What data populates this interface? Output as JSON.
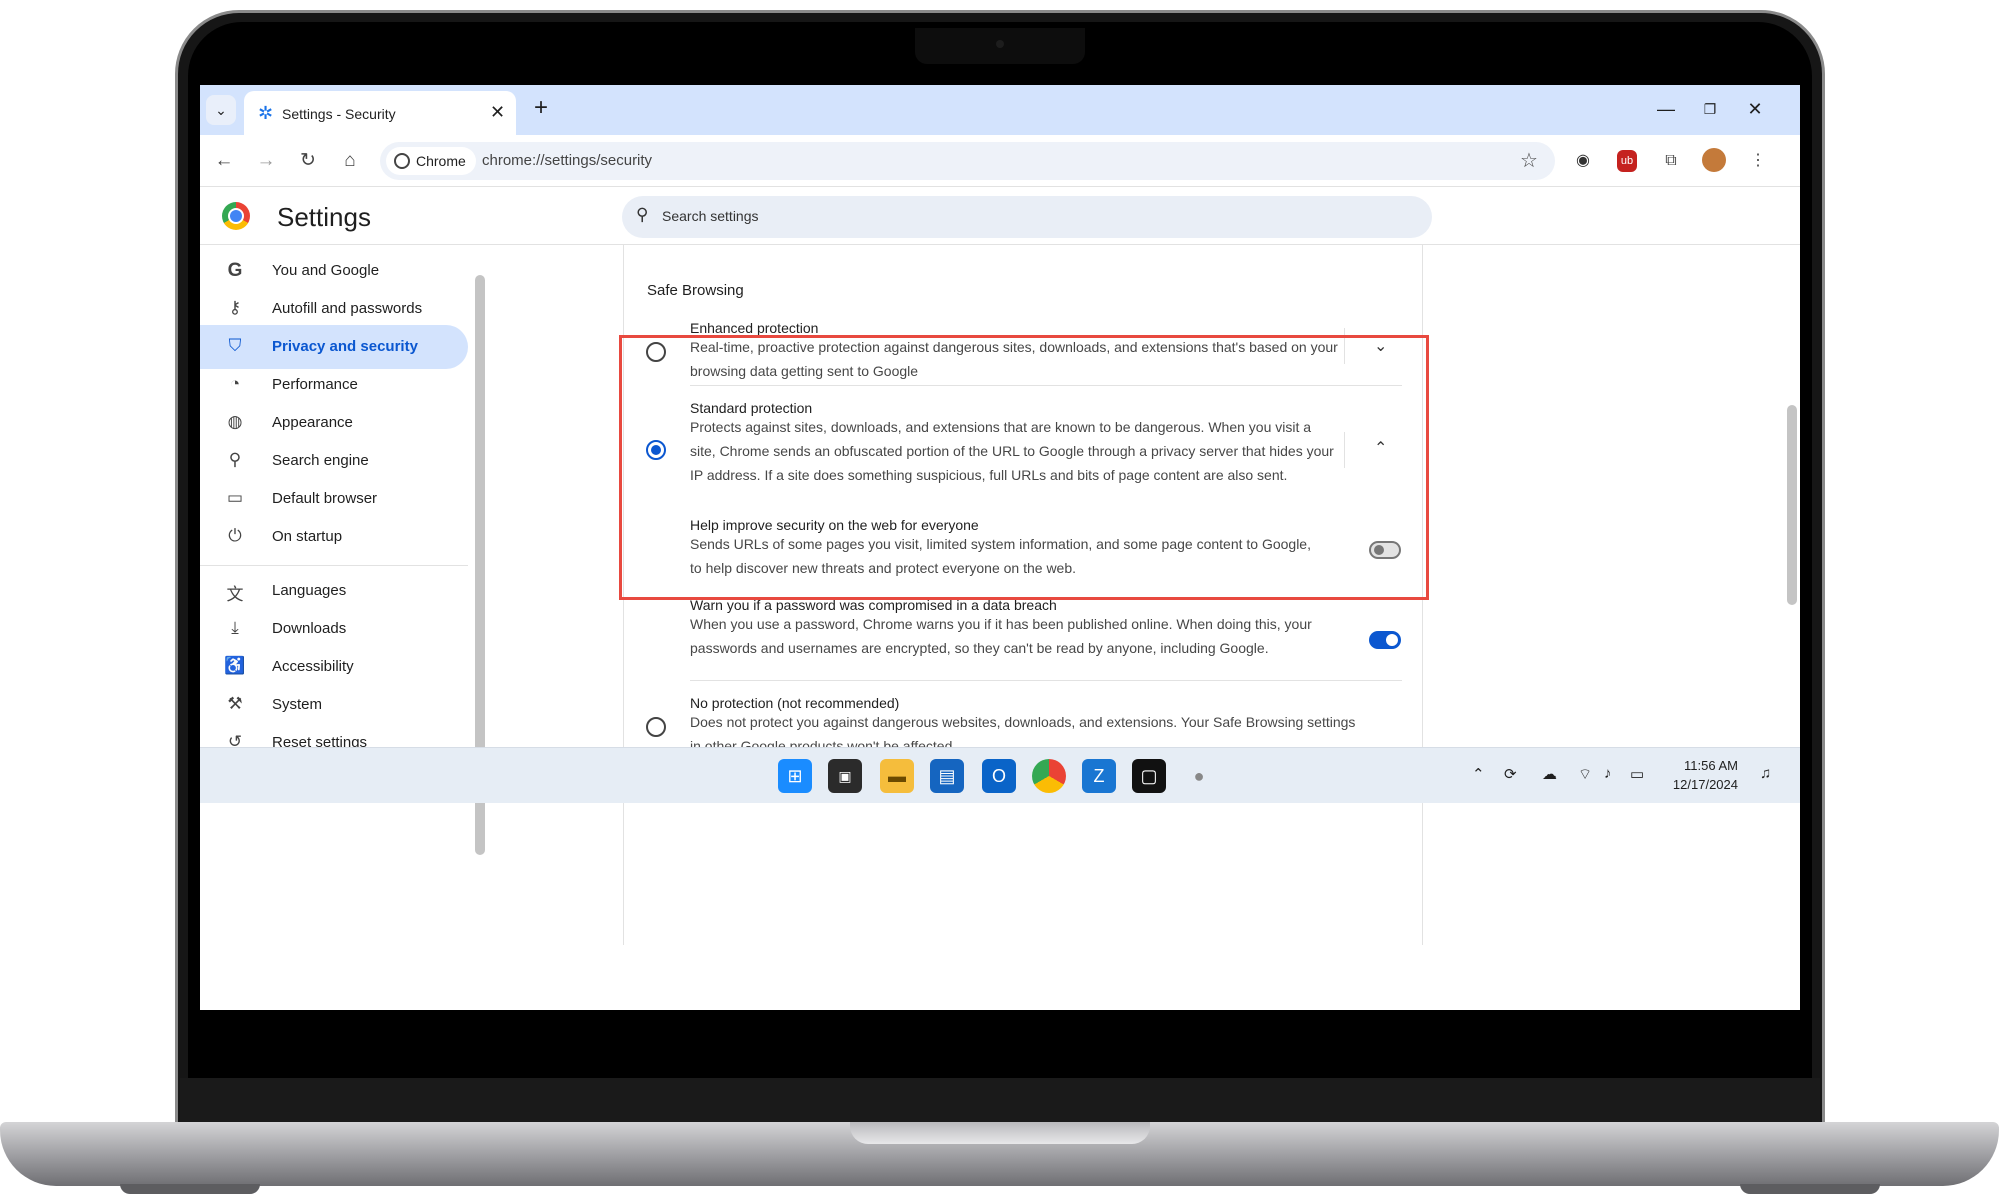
{
  "browser": {
    "tab_title": "Settings - Security",
    "chip_label": "Chrome",
    "url": "chrome://settings/security"
  },
  "settings": {
    "title": "Settings",
    "search_placeholder": "Search settings"
  },
  "sidebar": {
    "items": [
      {
        "label": "You and Google",
        "icon": "google-g-icon"
      },
      {
        "label": "Autofill and passwords",
        "icon": "key-icon"
      },
      {
        "label": "Privacy and security",
        "icon": "shield-icon",
        "active": true
      },
      {
        "label": "Performance",
        "icon": "speedometer-icon"
      },
      {
        "label": "Appearance",
        "icon": "palette-icon"
      },
      {
        "label": "Search engine",
        "icon": "search-icon"
      },
      {
        "label": "Default browser",
        "icon": "browser-window-icon"
      },
      {
        "label": "On startup",
        "icon": "power-icon"
      },
      {
        "label": "Languages",
        "icon": "translate-icon"
      },
      {
        "label": "Downloads",
        "icon": "download-icon"
      },
      {
        "label": "Accessibility",
        "icon": "accessibility-icon"
      },
      {
        "label": "System",
        "icon": "wrench-icon"
      },
      {
        "label": "Reset settings",
        "icon": "reset-icon"
      }
    ]
  },
  "safe_browsing": {
    "heading": "Safe Browsing",
    "enhanced": {
      "title": "Enhanced protection",
      "desc": "Real-time, proactive protection against dangerous sites, downloads, and extensions that's based on your browsing data getting sent to Google",
      "selected": false
    },
    "standard": {
      "title": "Standard protection",
      "desc": "Protects against sites, downloads, and extensions that are known to be dangerous. When you visit a site, Chrome sends an obfuscated portion of the URL to Google through a privacy server that hides your IP address. If a site does something suspicious, full URLs and bits of page content are also sent.",
      "selected": true
    },
    "help_improve": {
      "title": "Help improve security on the web for everyone",
      "desc": "Sends URLs of some pages you visit, limited system information, and some page content to Google, to help discover new threats and protect everyone on the web.",
      "enabled": false
    },
    "warn_password": {
      "title": "Warn you if a password was compromised in a data breach",
      "desc": "When you use a password, Chrome warns you if it has been published online. When doing this, your passwords and usernames are encrypted, so they can't be read by anyone, including Google.",
      "enabled": true
    },
    "no_protection": {
      "title": "No protection (not recommended)",
      "desc": "Does not protect you against dangerous websites, downloads, and extensions. Your Safe Browsing settings in other Google products won't be affected.",
      "selected": false
    }
  },
  "taskbar": {
    "time": "11:56 AM",
    "date": "12/17/2024"
  },
  "colors": {
    "accent": "#0b57d0",
    "highlight_border": "#e8493f",
    "tabstrip": "#d3e3fd"
  }
}
